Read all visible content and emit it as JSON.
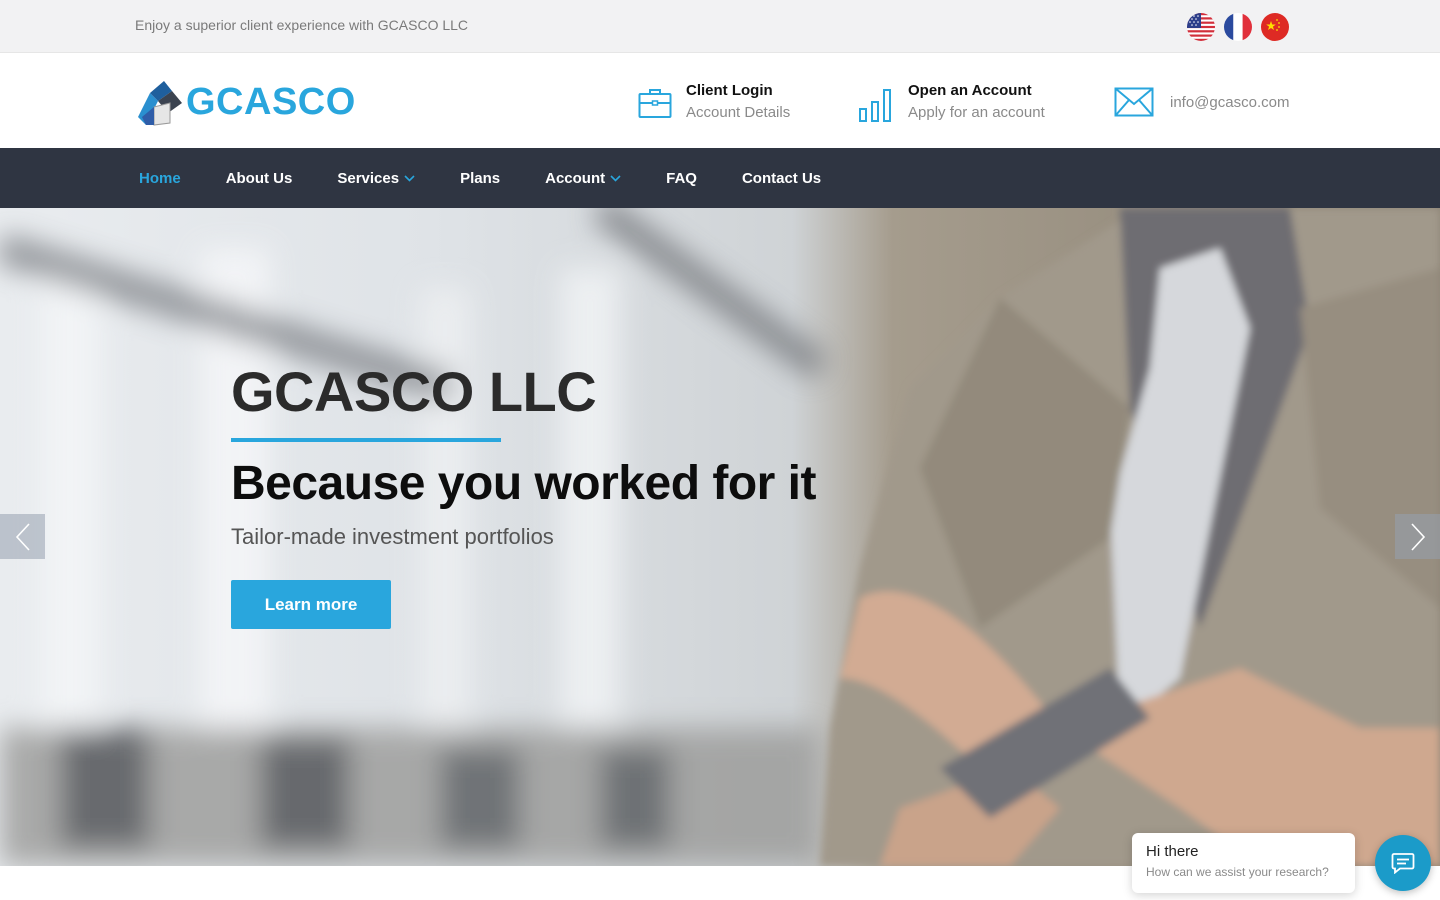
{
  "topbar": {
    "tagline": "Enjoy a superior client experience with GCASCO LLC",
    "flags": [
      "us-flag-icon",
      "france-flag-icon",
      "china-flag-icon"
    ]
  },
  "header": {
    "logo_text": "GCASCO",
    "client_login": {
      "title": "Client Login",
      "subtitle": "Account Details"
    },
    "open_account": {
      "title": "Open an Account",
      "subtitle": "Apply for an account"
    },
    "email": "info@gcasco.com"
  },
  "nav": {
    "items": [
      {
        "label": "Home"
      },
      {
        "label": "About Us"
      },
      {
        "label": "Services"
      },
      {
        "label": "Plans"
      },
      {
        "label": "Account"
      },
      {
        "label": "FAQ"
      },
      {
        "label": "Contact Us"
      }
    ]
  },
  "hero": {
    "title": "GCASCO LLC",
    "subtitle": "Because you worked for it",
    "description": "Tailor-made investment portfolios",
    "button": "Learn more"
  },
  "chat": {
    "greeting": "Hi there",
    "prompt": "How can we assist your research?"
  },
  "colors": {
    "accent": "#29a6dd",
    "nav_bg": "#2f3542"
  }
}
